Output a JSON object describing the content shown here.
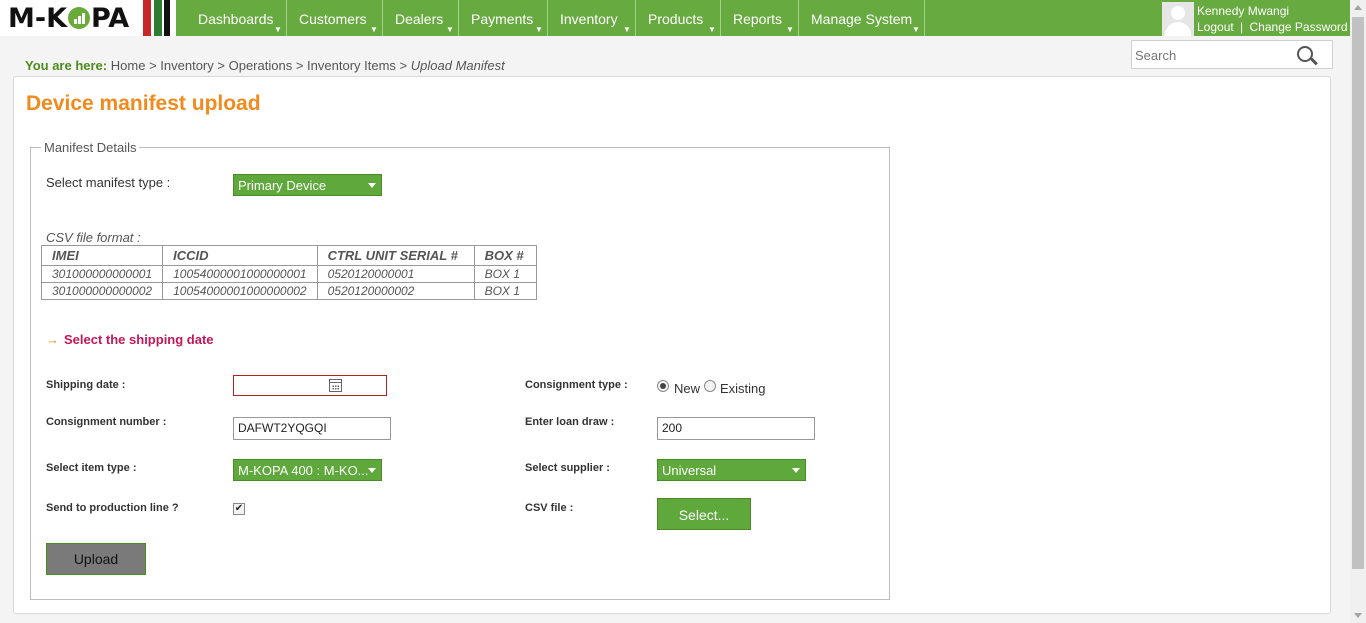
{
  "logo": {
    "text_before": "M-K",
    "text_after": "PA"
  },
  "nav": [
    {
      "label": "Dashboards"
    },
    {
      "label": "Customers"
    },
    {
      "label": "Dealers"
    },
    {
      "label": "Payments"
    },
    {
      "label": "Inventory"
    },
    {
      "label": "Products"
    },
    {
      "label": "Reports"
    },
    {
      "label": "Manage System"
    }
  ],
  "user": {
    "name": "Kennedy Mwangi",
    "logout": "Logout",
    "separator": "|",
    "change_password": "Change Password"
  },
  "search": {
    "placeholder": "Search"
  },
  "breadcrumb": {
    "lead": "You are here:",
    "items": [
      "Home",
      "Inventory",
      "Operations",
      "Inventory Items"
    ],
    "separator": ">",
    "current": "Upload Manifest"
  },
  "page": {
    "title": "Device manifest upload"
  },
  "manifest": {
    "legend": "Manifest Details",
    "type_label": "Select manifest type :",
    "type_value": "Primary Device",
    "csv_format_label": "CSV file format :",
    "csv_table": {
      "headers": [
        "IMEI",
        "ICCID",
        "CTRL UNIT SERIAL #",
        "BOX #"
      ],
      "rows": [
        [
          "301000000000001",
          "10054000001000000001",
          "0520120000001",
          "BOX 1"
        ],
        [
          "301000000000002",
          "10054000001000000002",
          "0520120000002",
          "BOX 1"
        ]
      ]
    },
    "shipping_heading": "Select the shipping date",
    "shipping_arrow": "→",
    "shipping_date_label": "Shipping date :",
    "shipping_date_value": "",
    "consignment_number_label": "Consignment number :",
    "consignment_number_value": "DAFWT2YQGQI",
    "item_type_label": "Select item type :",
    "item_type_value": "M-KOPA 400 : M-KO...",
    "production_label": "Send to production line ?",
    "production_checked": true,
    "consignment_type_label": "Consignment type :",
    "consignment_type_options": [
      "New",
      "Existing"
    ],
    "consignment_type_selected": "New",
    "loan_draw_label": "Enter loan draw :",
    "loan_draw_value": "200",
    "supplier_label": "Select supplier :",
    "supplier_value": "Universal",
    "csv_file_label": "CSV file :",
    "select_button": "Select...",
    "upload_button": "Upload"
  },
  "colors": {
    "brand_green": "#67aa3f",
    "title_orange": "#f28a1e",
    "heading_crimson": "#c2185b",
    "breadcrumb_green": "#4d8c1e"
  }
}
